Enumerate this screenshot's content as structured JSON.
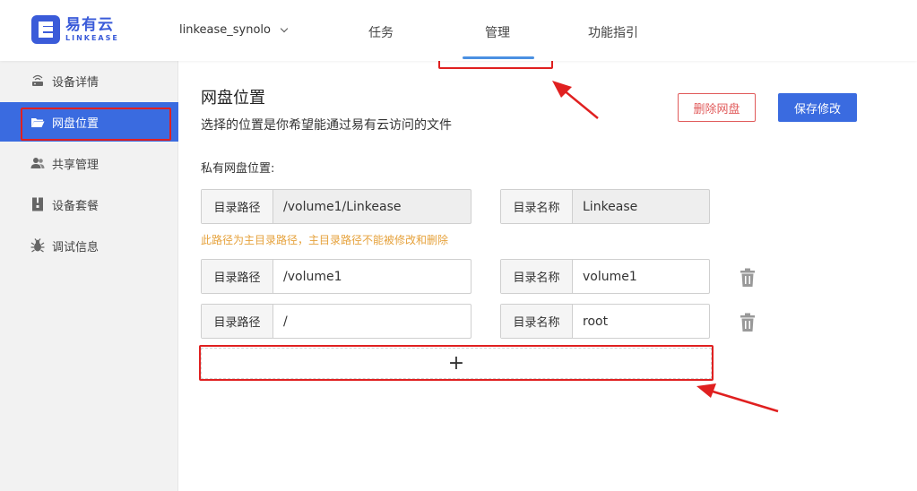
{
  "logo": {
    "cn": "易有云",
    "en": "LINKEASE"
  },
  "header": {
    "device": "linkease_synolo",
    "tabs": [
      {
        "label": "任务"
      },
      {
        "label": "管理"
      },
      {
        "label": "功能指引"
      }
    ],
    "active_tab": "管理"
  },
  "sidebar": {
    "items": [
      {
        "label": "设备详情",
        "icon": "router-icon"
      },
      {
        "label": "网盘位置",
        "icon": "folder-open-icon"
      },
      {
        "label": "共享管理",
        "icon": "users-icon"
      },
      {
        "label": "设备套餐",
        "icon": "package-icon"
      },
      {
        "label": "调试信息",
        "icon": "bug-icon"
      }
    ],
    "active": "网盘位置"
  },
  "main": {
    "title": "网盘位置",
    "subtitle": "选择的位置是你希望能通过易有云访问的文件",
    "delete_button": "删除网盘",
    "save_button": "保存修改",
    "section_label": "私有网盘位置:",
    "hint": "此路径为主目录路径，主目录路径不能被修改和删除",
    "path_label": "目录路径",
    "name_label": "目录名称",
    "rows": [
      {
        "path": "/volume1/Linkease",
        "name": "Linkease",
        "editable": false
      },
      {
        "path": "/volume1",
        "name": "volume1",
        "editable": true
      },
      {
        "path": "/",
        "name": "root",
        "editable": true
      }
    ],
    "add_label": "+"
  },
  "colors": {
    "accent": "#3a6be0",
    "danger": "#e05a5a",
    "hint": "#e6a23c",
    "annotation": "#e02020"
  }
}
